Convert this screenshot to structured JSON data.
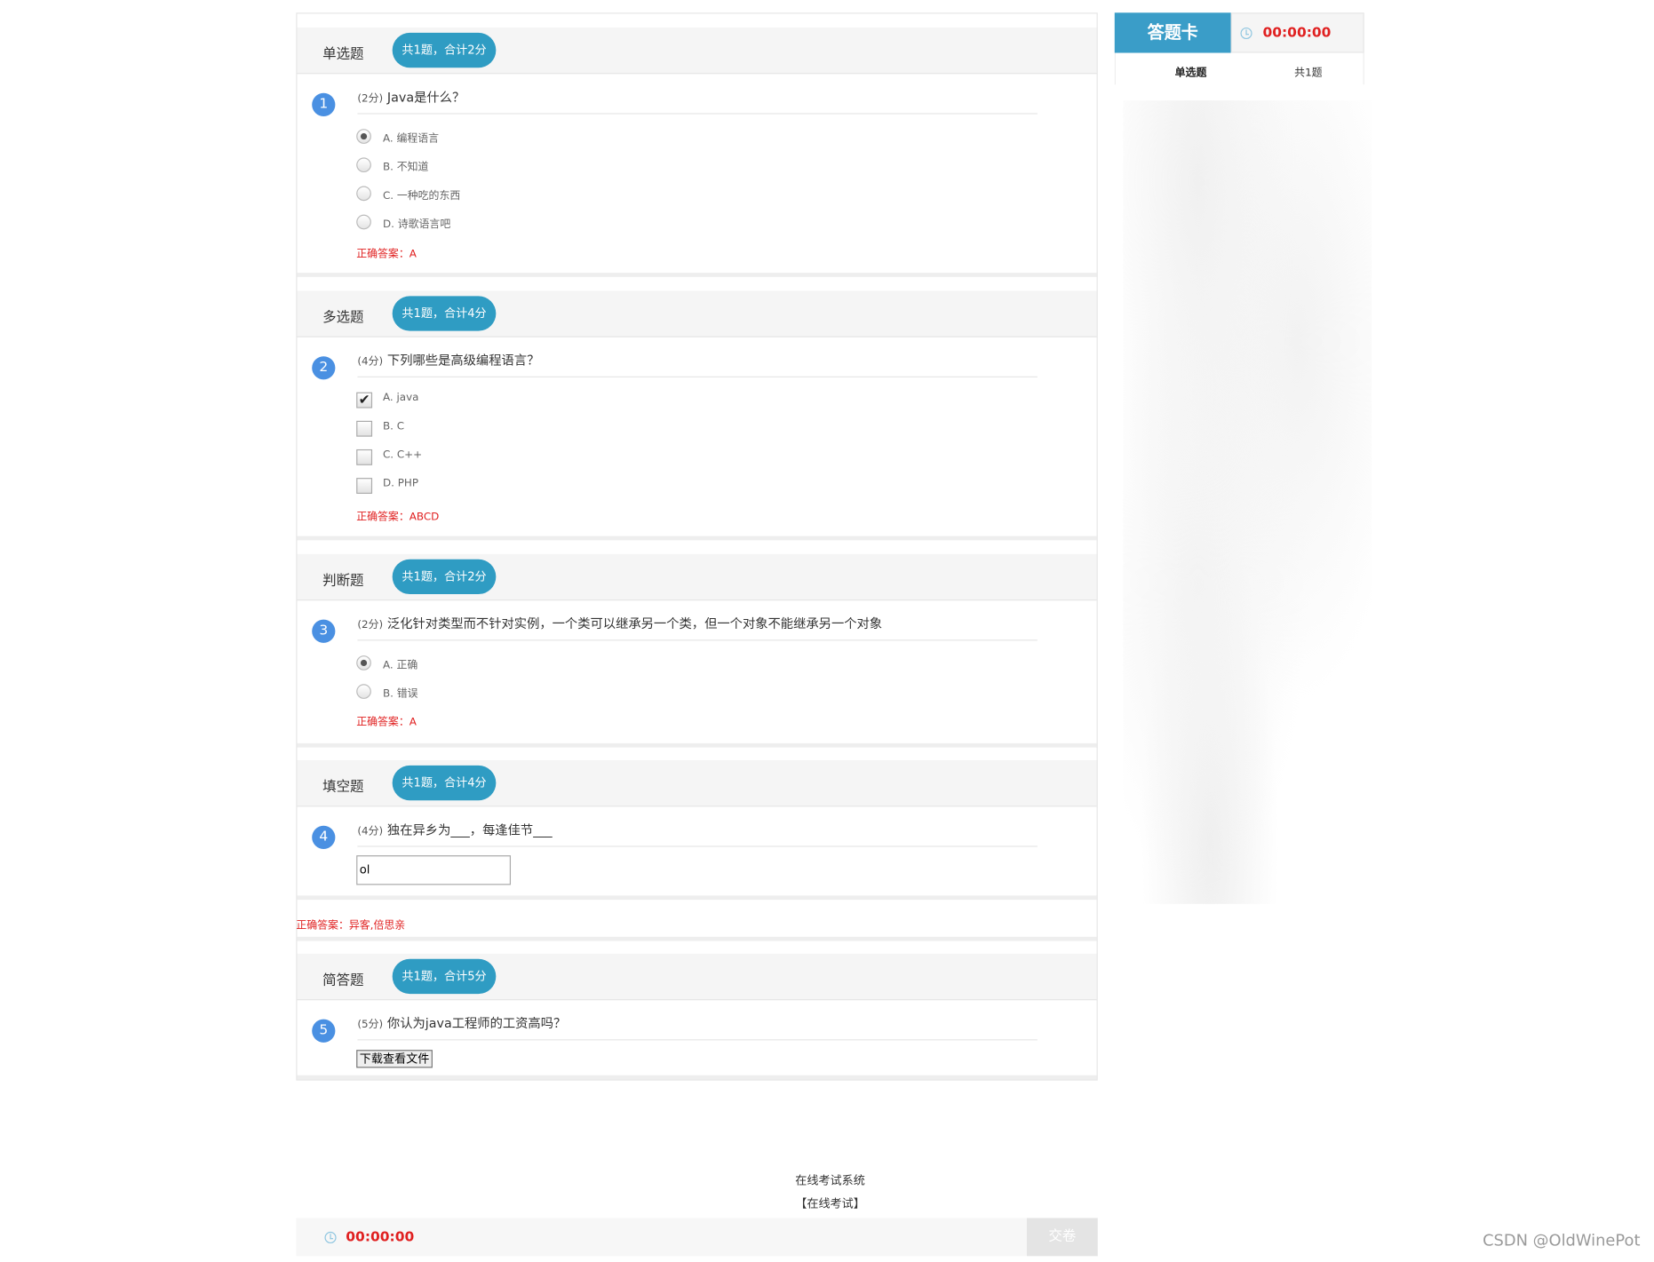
{
  "sections": [
    {
      "title": "单选题",
      "pill": "共1题，合计2分",
      "question": {
        "num": "1",
        "score": "(2分)",
        "text": "Java是什么？"
      },
      "options": [
        {
          "label": "A. 编程语言"
        },
        {
          "label": "B. 不知道"
        },
        {
          "label": "C. 一种吃的东西"
        },
        {
          "label": "D. 诗歌语言吧"
        }
      ],
      "answer": "正确答案：A"
    },
    {
      "title": "多选题",
      "pill": "共1题，合计4分",
      "question": {
        "num": "2",
        "score": "(4分)",
        "text": "下列哪些是高级编程语言？"
      },
      "options": [
        {
          "label": "A. java"
        },
        {
          "label": "B. C"
        },
        {
          "label": "C. C++"
        },
        {
          "label": "D. PHP"
        }
      ],
      "answer": "正确答案：ABCD"
    },
    {
      "title": "判断题",
      "pill": "共1题，合计2分",
      "question": {
        "num": "3",
        "score": "(2分)",
        "text": "泛化针对类型而不针对实例，一个类可以继承另一个类，但一个对象不能继承另一个对象"
      },
      "options": [
        {
          "label": "A. 正确"
        },
        {
          "label": "B. 错误"
        }
      ],
      "answer": "正确答案：A"
    },
    {
      "title": "填空题",
      "pill": "共1题，合计4分",
      "question": {
        "num": "4",
        "score": "(4分)",
        "text": "独在异乡为___，每逢佳节___"
      },
      "input_value": "ol",
      "answer": "正确答案：异客,倍思亲"
    },
    {
      "title": "简答题",
      "pill": "共1题，合计5分",
      "question": {
        "num": "5",
        "score": "(5分)",
        "text": "你认为java工程师的工资高吗？"
      },
      "button": "下载查看文件"
    }
  ],
  "answer_card": {
    "title": "答题卡",
    "timer": "00:00:00",
    "row_type": "单选题",
    "row_count": "共1题"
  },
  "footer": {
    "line1": "在线考试系统",
    "line2": "【在线考试】"
  },
  "bottom_bar": {
    "timer": "00:00:00",
    "submit": "交卷"
  },
  "watermark": "CSDN @OldWinePot",
  "colors": {
    "accent": "#2f9cc3",
    "answer": "#e02020",
    "number": "#4a90e2"
  }
}
